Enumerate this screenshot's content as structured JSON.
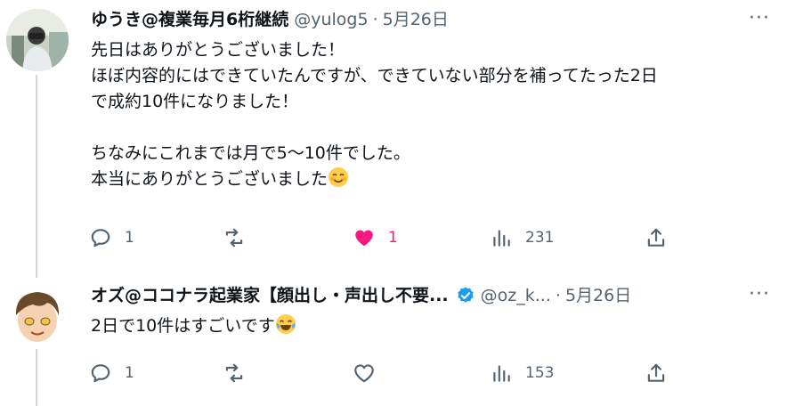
{
  "tweets": [
    {
      "author_name": "ゆうき@複業毎月6桁継続",
      "handle": "@yulog5",
      "separator": "·",
      "date": "5月26日",
      "more": "···",
      "text_lines": [
        "先日はありがとうございました！",
        "ほぼ内容的にはできていたんですが、できていない部分を補ってたった2日",
        "で成約10件になりました！",
        "",
        "ちなみにこれまでは月で5〜10件でした。",
        "本当にありがとうございました"
      ],
      "end_emoji": "smiling-face-emoji",
      "replies": "1",
      "retweets": "",
      "likes": "1",
      "liked": true,
      "views": "231"
    },
    {
      "author_name": "オズ@ココナラ起業家【顔出し・声出し不要...",
      "verified": true,
      "handle": "@oz_k...",
      "separator": "·",
      "date": "5月26日",
      "more": "···",
      "text_lines": [
        "2日で10件はすごいです"
      ],
      "end_emoji": "joy-tears-emoji",
      "replies": "1",
      "retweets": "",
      "likes": "",
      "liked": false,
      "views": "153"
    }
  ],
  "colors": {
    "like_active": "#f91880",
    "verified": "#1d9bf0",
    "muted": "#536471"
  }
}
